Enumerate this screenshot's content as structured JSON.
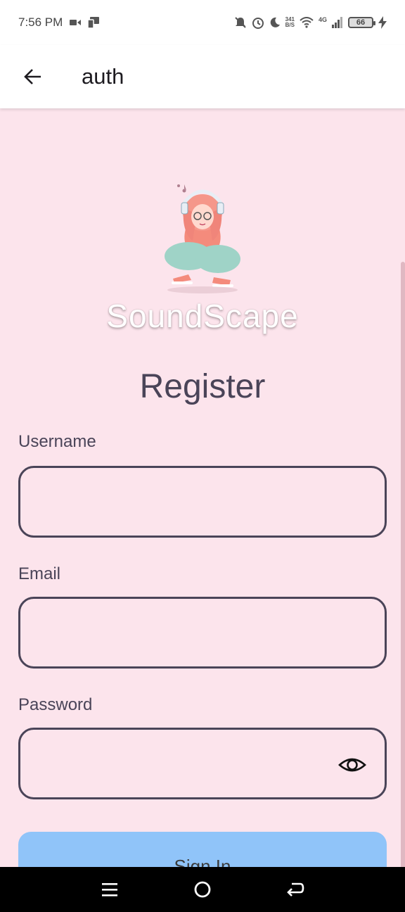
{
  "status_bar": {
    "time": "7:56 PM",
    "net_speed_value": "341",
    "net_speed_unit": "B/S",
    "network_type": "4G",
    "battery_level": "66"
  },
  "app_bar": {
    "title": "auth"
  },
  "brand": {
    "name": "SoundScape"
  },
  "form": {
    "heading": "Register",
    "username_label": "Username",
    "username_value": "",
    "email_label": "Email",
    "email_value": "",
    "password_label": "Password",
    "password_value": "",
    "submit_label": "Sign In"
  },
  "icons": {
    "back": "arrow-left-icon",
    "password_toggle": "eye-icon",
    "nav_menu": "menu-icon",
    "nav_home": "home-circle-icon",
    "nav_back": "return-icon"
  },
  "colors": {
    "background": "#fce4ec",
    "button": "#90c4f9",
    "text": "#4a4458"
  }
}
